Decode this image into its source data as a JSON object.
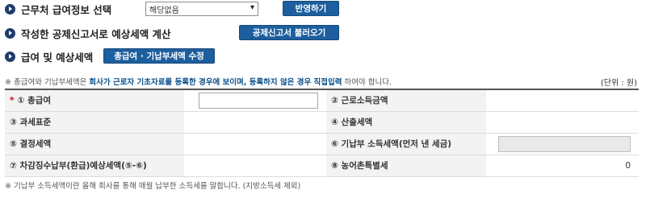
{
  "sections": {
    "work_select": {
      "title": "근무처 급여정보 선택",
      "select_value": "해당없음",
      "apply_button": "반영하기"
    },
    "deduction": {
      "title": "작성한 공제신고서로 예상세액 계산",
      "load_button": "공제신고서 불러오기"
    },
    "salary": {
      "title": "급여 및 예상세액",
      "edit_button": "총급여 · 기납부세액 수정"
    }
  },
  "notice": {
    "prefix": "※ 총급여와 기납부세액은 ",
    "emphasis": "회사가 근로자 기초자료를 등록한 경우에 보이며, 등록하지 않은 경우 직접입력",
    "suffix": " 하여야 합니다."
  },
  "unit": "(단위 : 원)",
  "table": {
    "required_mark": "*",
    "rows": [
      {
        "left_label": "① 총급여",
        "left_value": "",
        "right_label": "② 근로소득금액",
        "right_value": ""
      },
      {
        "left_label": "③ 과세표준",
        "left_value": "",
        "right_label": "④ 산출세액",
        "right_value": ""
      },
      {
        "left_label": "⑤ 결정세액",
        "left_value": "",
        "right_label": "⑥ 기납부 소득세액(먼저 낸 세금)",
        "right_value": ""
      },
      {
        "left_label": "⑦ 차감징수납부(환급)예상세액(⑤-⑥)",
        "left_value": "",
        "right_label": "⑧ 농어촌특별세",
        "right_value": "0"
      }
    ]
  },
  "footnote": "※ 기납부 소득세액이란 올해 회사를 통해 매월 납부한 소득세를 말합니다. (지방소득세 제외)"
}
